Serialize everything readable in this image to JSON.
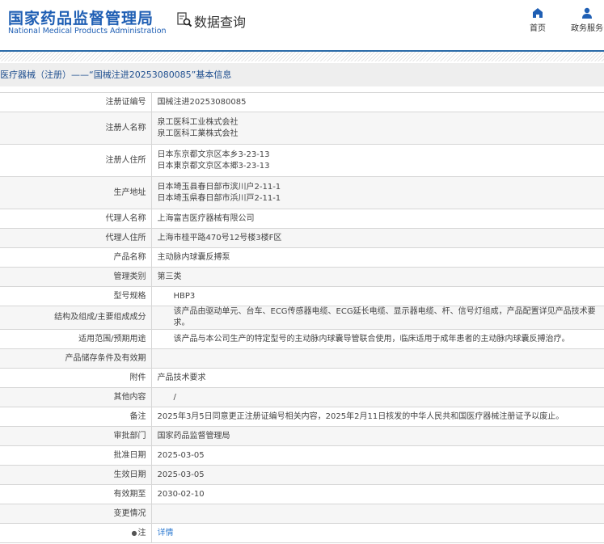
{
  "header": {
    "logo_cn": "国家药品监督管理局",
    "logo_en": "National Medical Products Administration",
    "section": "数据查询",
    "nav": [
      {
        "label": "首页",
        "icon": "home-icon"
      },
      {
        "label": "政务服务",
        "icon": "user-icon"
      }
    ]
  },
  "title": "医疗器械（注册）——“国械注进20253080085”基本信息",
  "rows": [
    {
      "label": "注册证编号",
      "lines": [
        "国械注进20253080085"
      ]
    },
    {
      "label": "注册人名称",
      "lines": [
        "泉工医科工业株式会社",
        "泉工医科工業株式会社"
      ]
    },
    {
      "label": "注册人住所",
      "lines": [
        "日本东京都文京区本乡3-23-13",
        "日本東京都文京区本郷3-23-13"
      ]
    },
    {
      "label": "生产地址",
      "lines": [
        "日本埼玉县春日部市滨川户2-11-1",
        "日本埼玉県春日部市浜川戸2-11-1"
      ]
    },
    {
      "label": "代理人名称",
      "lines": [
        "上海富吉医疗器械有限公司"
      ]
    },
    {
      "label": "代理人住所",
      "lines": [
        "上海市桂平路470号12号楼3楼F区"
      ]
    },
    {
      "label": "产品名称",
      "lines": [
        "主动脉内球囊反搏泵"
      ]
    },
    {
      "label": "管理类别",
      "lines": [
        "第三类"
      ]
    },
    {
      "label": "型号规格",
      "lines": [
        "HBP3"
      ],
      "indent": true
    },
    {
      "label": "结构及组成/主要组成成分",
      "lines": [
        "该产品由驱动单元、台车、ECG传感器电缆、ECG延长电缆、显示器电缆、杆、信号灯组成，产品配置详见产品技术要求。"
      ],
      "indent": true
    },
    {
      "label": "适用范围/预期用途",
      "lines": [
        "该产品与本公司生产的特定型号的主动脉内球囊导管联合使用，临床适用于成年患者的主动脉内球囊反搏治疗。"
      ],
      "indent": true
    },
    {
      "label": "产品储存条件及有效期",
      "lines": [
        ""
      ]
    },
    {
      "label": "附件",
      "lines": [
        "产品技术要求"
      ]
    },
    {
      "label": "其他内容",
      "lines": [
        "/"
      ],
      "indent": true
    },
    {
      "label": "备注",
      "lines": [
        "2025年3月5日同意更正注册证编号相关内容，2025年2月11日核发的中华人民共和国医疗器械注册证予以废止。"
      ]
    },
    {
      "label": "审批部门",
      "lines": [
        "国家药品监督管理局"
      ]
    },
    {
      "label": "批准日期",
      "lines": [
        "2025-03-05"
      ]
    },
    {
      "label": "生效日期",
      "lines": [
        "2025-03-05"
      ]
    },
    {
      "label": "有效期至",
      "lines": [
        "2030-02-10"
      ]
    },
    {
      "label": "变更情况",
      "lines": [
        ""
      ]
    },
    {
      "label": "注",
      "lines": [
        "详情"
      ],
      "link": true
    }
  ]
}
